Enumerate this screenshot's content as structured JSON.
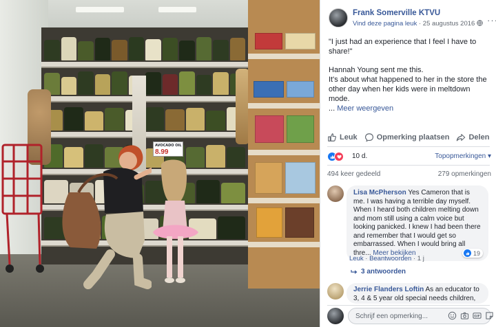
{
  "photo": {
    "price_tag_main": "8.99",
    "tag_text": "AVOCADO OIL"
  },
  "post": {
    "page_name": "Frank Somerville KTVU",
    "like_page": "Vind deze pagina leuk",
    "separator": "·",
    "date": "25 augustus 2016",
    "quote": "\"I just had an experience that I feel I have to share!\"",
    "line1": "Hannah Young sent me this.",
    "line2": "It's about what happened to her in the store the other day when her kids were in meltdown mode.",
    "ellipsis": "...",
    "see_more": "Meer weergeven"
  },
  "actions": {
    "like": "Leuk",
    "comment": "Opmerking plaatsen",
    "share": "Delen"
  },
  "reactions": {
    "count": "10 d.",
    "sort_label": "Topopmerkingen ▾"
  },
  "stats": {
    "shares": "494 keer gedeeld",
    "comments": "279 opmerkingen"
  },
  "comments": [
    {
      "author": "Lisa McPherson",
      "text": "Yes Cameron that is me. I was having a terrible day myself. When I heard both children melting down and mom still using a calm voice but looking panicked. I knew I had been there and remember that I would get so embarrassed. When I would bring all thre...",
      "see_more": "Meer bekijken",
      "like": "Leuk",
      "reply": "Beantwoorden",
      "time": "1 j",
      "dot": "·",
      "likes": "19",
      "replies": "3 antwoorden"
    },
    {
      "author": "Jerrie Flanders Loftin",
      "text": "As an educator to 3, 4 & 5 year old special needs children,"
    }
  ],
  "composer": {
    "placeholder": "Schrijf een opmerking..."
  },
  "colors": {
    "link": "#385898",
    "like_blue": "#1877f2",
    "love_red": "#f33e58"
  }
}
